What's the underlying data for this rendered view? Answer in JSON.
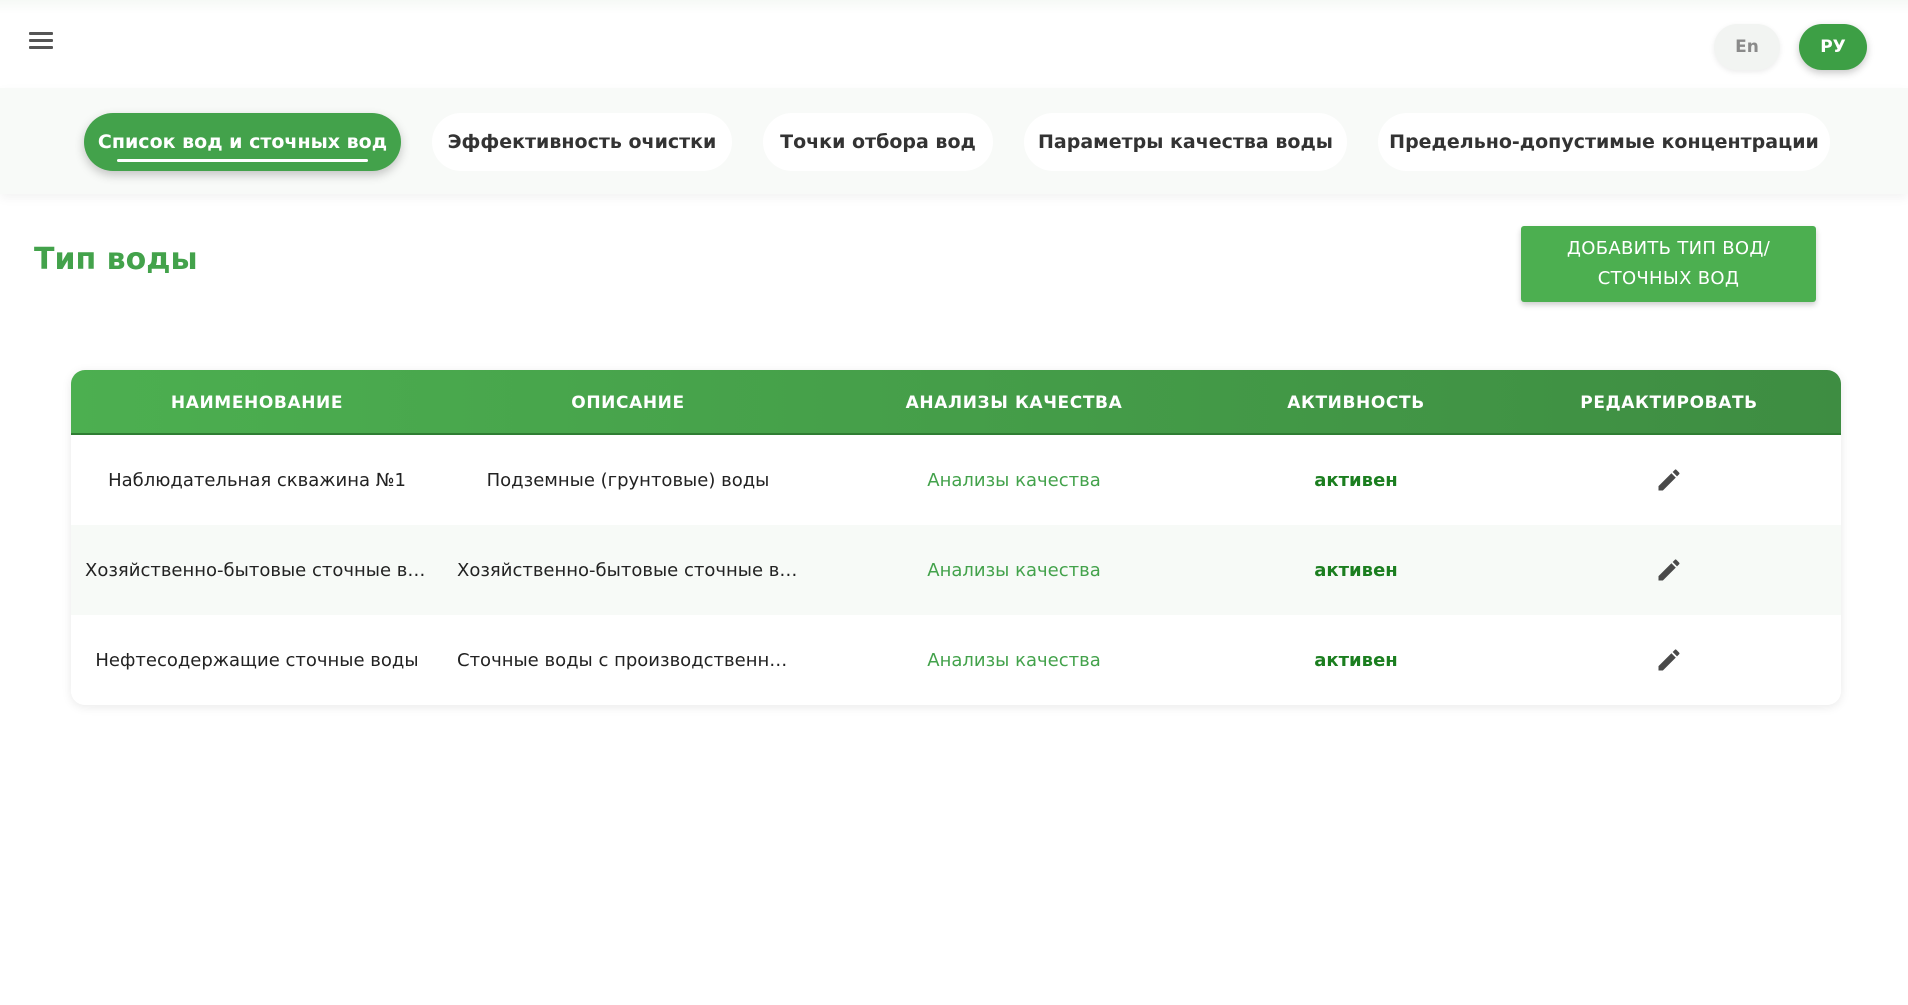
{
  "header": {
    "menu_icon": "menu-icon",
    "lang_en": "En",
    "lang_ru": "РУ"
  },
  "tabs": [
    {
      "label": "Список вод и сточных вод",
      "active": true
    },
    {
      "label": "Эффективность очистки",
      "active": false
    },
    {
      "label": "Точки отбора вод",
      "active": false
    },
    {
      "label": "Параметры качества воды",
      "active": false
    },
    {
      "label": "Предельно-допустимые концентрации",
      "active": false
    }
  ],
  "main": {
    "title": "Тип воды",
    "add_button": "ДОБАВИТЬ ТИП ВОД/ СТОЧНЫХ ВОД"
  },
  "table": {
    "columns": [
      "НАИМЕНОВАНИЕ",
      "ОПИСАНИЕ",
      "АНАЛИЗЫ КАЧЕСТВА",
      "АКТИВНОСТЬ",
      "РЕДАКТИРОВАТЬ"
    ],
    "rows": [
      {
        "name": "Наблюдательная скважина №1",
        "description": "Подземные (грунтовые) воды",
        "analyses": "Анализы качества",
        "status": "активен",
        "edit_icon": "pencil-icon"
      },
      {
        "name": "Хозяйственно-бытовые сточные во...",
        "description": "Хозяйственно-бытовые сточные во...",
        "analyses": "Анализы качества",
        "status": "активен",
        "edit_icon": "pencil-icon"
      },
      {
        "name": "Нефтесодержащие сточные воды",
        "description": "Сточные воды с производственны...",
        "analyses": "Анализы качества",
        "status": "активен",
        "edit_icon": "pencil-icon"
      }
    ]
  },
  "colors": {
    "accent": "#43a24b",
    "header_gradient_start": "#4caf50",
    "header_gradient_end": "#3e8d42",
    "status_active": "#1b7e1f"
  }
}
